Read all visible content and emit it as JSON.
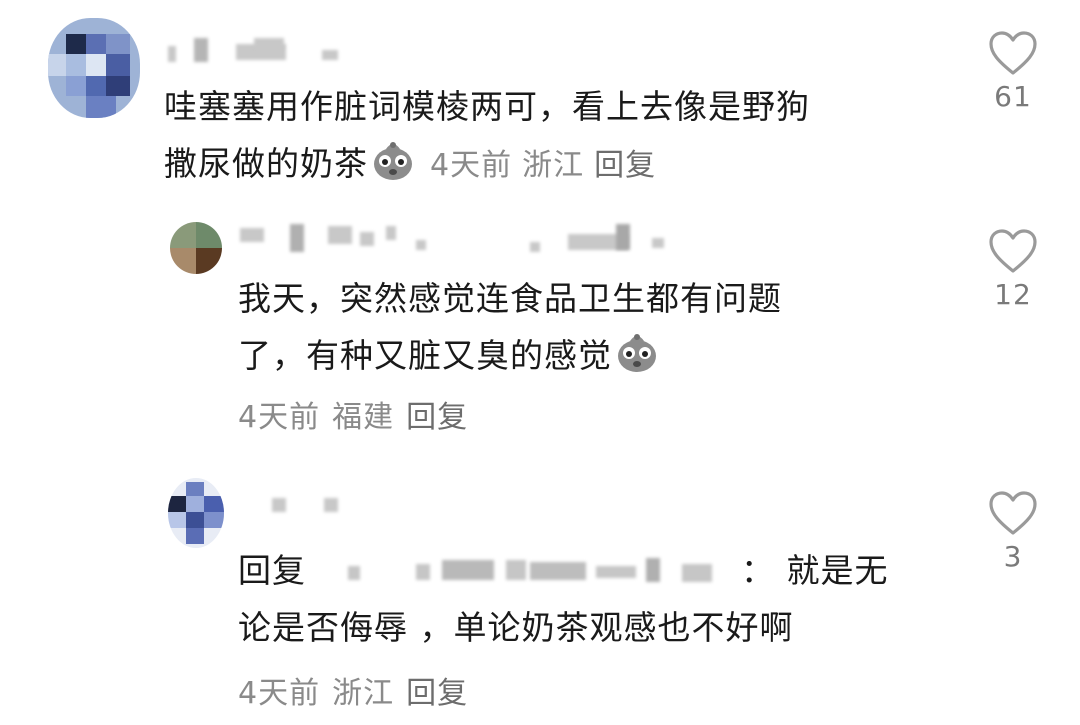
{
  "comments": [
    {
      "text_lines": [
        "哇塞塞用作脏词模棱两可，看上去像是野狗",
        "撒尿做的奶茶"
      ],
      "sticker_icon": "sticker-face-icon",
      "time": "4天前",
      "location": "浙江",
      "reply_label": "回复",
      "likes": "61"
    },
    {
      "text_lines": [
        "我天，突然感觉连食品卫生都有问题",
        "了，有种又脏又臭的感觉"
      ],
      "sticker_icon": "sticker-face-icon",
      "time": "4天前",
      "location": "福建",
      "reply_label": "回复",
      "likes": "12"
    },
    {
      "reply_prefix": "回复",
      "text_line1_suffix": "： 就是无",
      "text_line2": "论是否侮辱 ，单论奶茶观感也不好啊",
      "time": "4天前",
      "location": "浙江",
      "reply_label": "回复",
      "likes": "3"
    }
  ],
  "icons": {
    "like": "heart-outline-icon",
    "sticker": "sticker-face-icon"
  },
  "colors": {
    "text": "#1a1a1a",
    "meta": "#8a8a8a",
    "heart_stroke": "#9a9a9a"
  }
}
